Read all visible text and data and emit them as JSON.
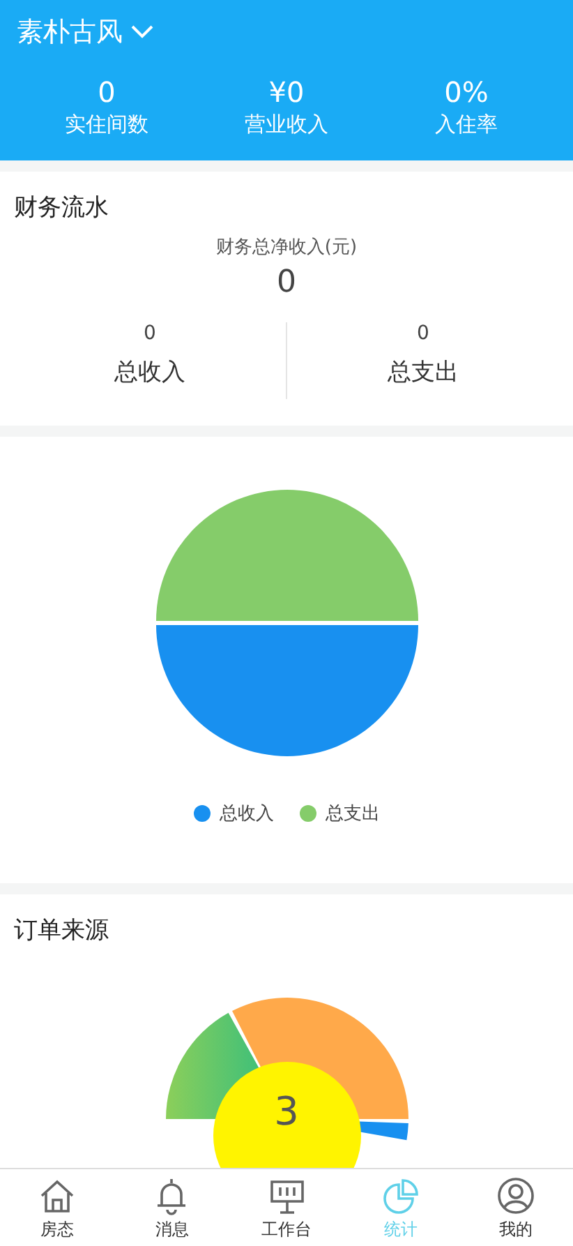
{
  "header": {
    "hotel": "素朴古风",
    "stats": [
      {
        "value": "0",
        "label": "实住间数"
      },
      {
        "value": "¥0",
        "label": "营业收入"
      },
      {
        "value": "0%",
        "label": "入住率"
      }
    ]
  },
  "finance": {
    "title": "财务流水",
    "net_label": "财务总净收入(元)",
    "net_value": "0",
    "totals": [
      {
        "value": "0",
        "label": "总收入"
      },
      {
        "value": "0",
        "label": "总支出"
      }
    ]
  },
  "pie": {
    "legend": [
      {
        "label": "总收入",
        "color": "#1890f0"
      },
      {
        "label": "总支出",
        "color": "#85cc6a"
      }
    ]
  },
  "orders": {
    "title": "订单来源",
    "center_value": "3"
  },
  "nav": [
    {
      "label": "房态",
      "kind": "home",
      "selected": false
    },
    {
      "label": "消息",
      "kind": "bell",
      "selected": false
    },
    {
      "label": "工作台",
      "kind": "board",
      "selected": false
    },
    {
      "label": "统计",
      "kind": "pie",
      "selected": true
    },
    {
      "label": "我的",
      "kind": "user",
      "selected": false
    }
  ]
}
